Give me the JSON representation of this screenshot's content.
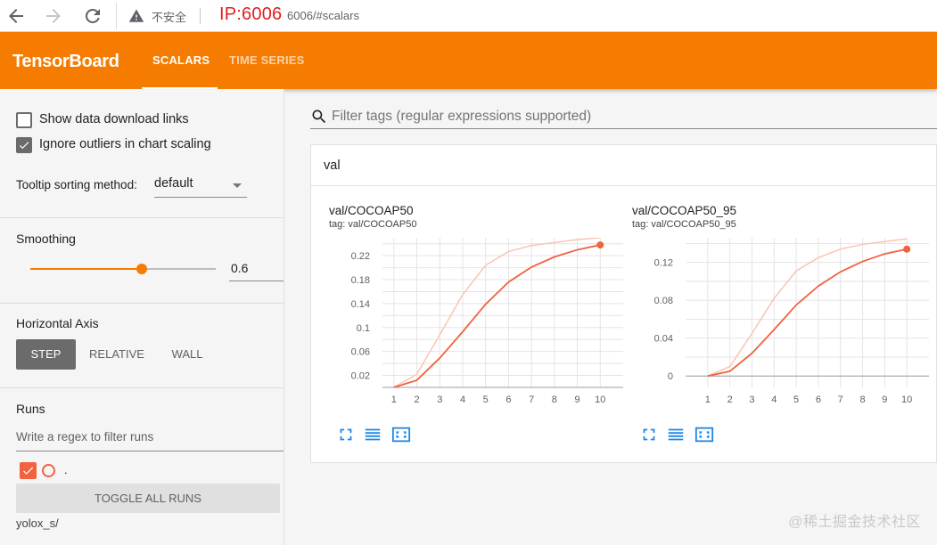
{
  "browser": {
    "insecure_label": "不安全",
    "ip_overlay": "IP:6006",
    "url_rest": "6006/#scalars"
  },
  "header": {
    "title": "TensorBoard",
    "tabs": [
      {
        "label": "SCALARS",
        "active": true
      },
      {
        "label": "TIME SERIES",
        "active": false
      }
    ]
  },
  "sidebar": {
    "show_download_links": {
      "label": "Show data download links",
      "checked": false
    },
    "ignore_outliers": {
      "label": "Ignore outliers in chart scaling",
      "checked": true
    },
    "tooltip_sorting": {
      "label": "Tooltip sorting method:",
      "value": "default"
    },
    "smoothing": {
      "title": "Smoothing",
      "value": "0.6",
      "level": 0.6
    },
    "horizontal_axis": {
      "title": "Horizontal Axis",
      "options": [
        "STEP",
        "RELATIVE",
        "WALL"
      ],
      "selected": "STEP"
    },
    "runs": {
      "title": "Runs",
      "filter_placeholder": "Write a regex to filter runs",
      "run_label": ".",
      "toggle_label": "TOGGLE ALL RUNS",
      "run_item": "yolox_s/"
    }
  },
  "main": {
    "search_placeholder": "Filter tags (regular expressions supported)",
    "group_title": "val",
    "watermark": "@稀土掘金技术社区"
  },
  "colors": {
    "brand": "#f57c00",
    "run_line": "#f1623f",
    "run_line_raw": "#f9c4b5"
  },
  "chart_data": [
    {
      "type": "line",
      "title": "val/COCOAP50",
      "subtitle": "tag: val/COCOAP50",
      "x": [
        1,
        2,
        3,
        4,
        5,
        6,
        7,
        8,
        9,
        10
      ],
      "xlim": [
        0.5,
        11
      ],
      "ylim": [
        0,
        0.25
      ],
      "yticks": [
        "0.02",
        "0.06",
        "0.1",
        "0.14",
        "0.18",
        "0.22"
      ],
      "ytick_values": [
        0.02,
        0.06,
        0.1,
        0.14,
        0.18,
        0.22
      ],
      "grid": true,
      "series": [
        {
          "values": [
            0.0,
            0.012,
            0.049,
            0.093,
            0.139,
            0.176,
            0.201,
            0.218,
            0.23,
            0.238
          ]
        },
        {
          "values": [
            0.0,
            0.022,
            0.088,
            0.155,
            0.204,
            0.227,
            0.237,
            0.242,
            0.247,
            0.25
          ]
        }
      ]
    },
    {
      "type": "line",
      "title": "val/COCOAP50_95",
      "subtitle": "tag: val/COCOAP50_95",
      "x": [
        1,
        2,
        3,
        4,
        5,
        6,
        7,
        8,
        9,
        10
      ],
      "xlim": [
        0,
        11
      ],
      "ylim": [
        -0.012,
        0.146
      ],
      "yticks": [
        "0",
        "0.04",
        "0.08",
        "0.12"
      ],
      "ytick_values": [
        0,
        0.04,
        0.08,
        0.12
      ],
      "grid": true,
      "series": [
        {
          "values": [
            0.0,
            0.005,
            0.024,
            0.049,
            0.075,
            0.095,
            0.11,
            0.121,
            0.129,
            0.134
          ]
        },
        {
          "values": [
            0.0,
            0.01,
            0.045,
            0.082,
            0.111,
            0.125,
            0.134,
            0.139,
            0.142,
            0.145
          ]
        }
      ]
    }
  ]
}
